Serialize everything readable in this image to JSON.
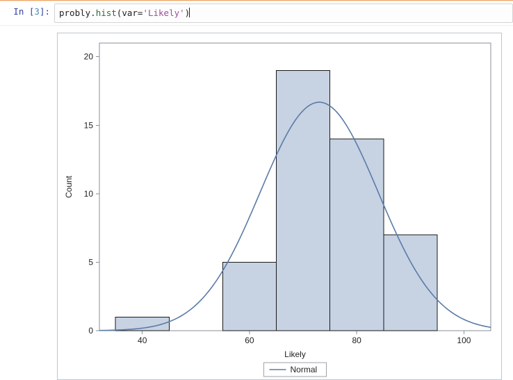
{
  "cell": {
    "prompt_prefix": "In [",
    "prompt_number": "3",
    "prompt_suffix": "]:",
    "code_obj": "probly",
    "code_dot": ".",
    "code_method": "hist",
    "code_open": "(",
    "code_kw": "var=",
    "code_str": "'Likely'",
    "code_close": ")"
  },
  "chart_data": {
    "type": "bar",
    "title": "",
    "xlabel": "Likely",
    "ylabel": "Count",
    "x_ticks": [
      40,
      60,
      80,
      100
    ],
    "y_ticks": [
      0,
      5,
      10,
      15,
      20
    ],
    "xlim": [
      32,
      105
    ],
    "ylim": [
      0,
      21
    ],
    "bin_width": 10,
    "bars": [
      {
        "x0": 35,
        "x1": 45,
        "count": 1
      },
      {
        "x0": 55,
        "x1": 65,
        "count": 5
      },
      {
        "x0": 65,
        "x1": 75,
        "count": 19
      },
      {
        "x0": 75,
        "x1": 85,
        "count": 14
      },
      {
        "x0": 85,
        "x1": 95,
        "count": 7
      }
    ],
    "curve": {
      "name": "Normal",
      "mean": 73,
      "sd": 11,
      "n": 46,
      "bin_width": 10
    },
    "legend": {
      "entries": [
        "Normal"
      ]
    }
  }
}
